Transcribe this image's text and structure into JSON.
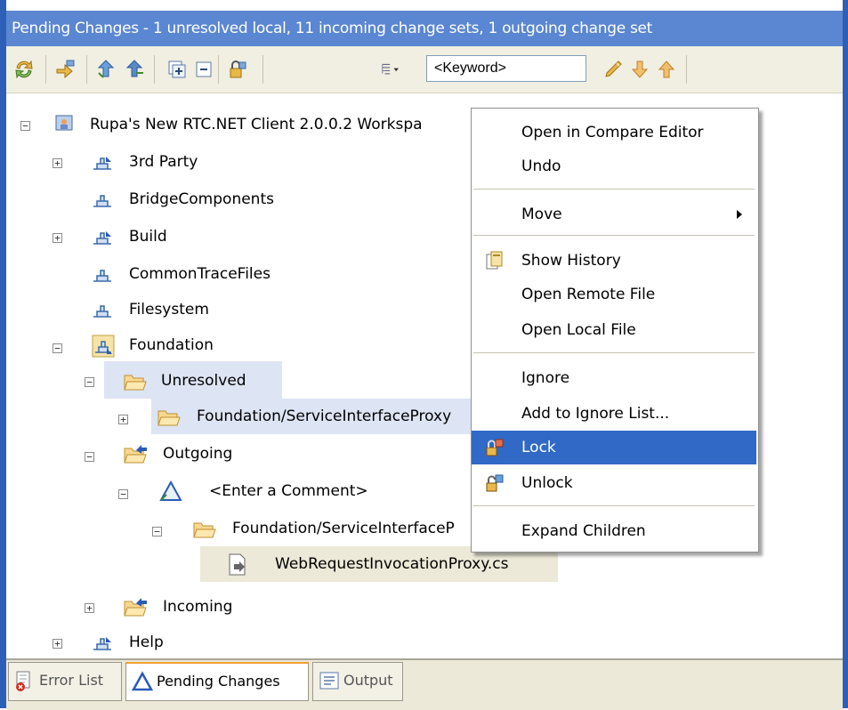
{
  "window": {
    "title": "Pending Changes - 1 unresolved local, 11 incoming change sets, 1 outgoing change set"
  },
  "toolbar": {
    "keyword_value": "<Keyword>",
    "icons": [
      "refresh-icon",
      "accept-icon",
      "check-in-icon",
      "deliver-icon",
      "expand-all-icon",
      "collapse-all-icon",
      "lock-icon",
      "filter-dropdown-icon",
      "search-icon",
      "next-icon",
      "previous-icon"
    ]
  },
  "tree": {
    "workspace": "Rupa's New RTC.NET Client 2.0.0.2 Workspa",
    "components": {
      "third_party": "3rd Party",
      "bridge": "BridgeComponents",
      "build": "Build",
      "trace": "CommonTraceFiles",
      "filesystem": "Filesystem",
      "foundation": "Foundation",
      "help": "Help"
    },
    "unresolved": "Unresolved",
    "unresolved_item": "Foundation/ServiceInterfaceProxy",
    "outgoing": "Outgoing",
    "comment": "<Enter a Comment>",
    "outgoing_folder": "Foundation/ServiceInterfaceP",
    "file": "WebRequestInvocationProxy.cs",
    "incoming": "Incoming"
  },
  "context_menu": {
    "items": [
      {
        "label": "Open in Compare Editor"
      },
      {
        "label": "Undo"
      },
      {
        "label": "Move"
      },
      {
        "label": "Show History"
      },
      {
        "label": "Open Remote File"
      },
      {
        "label": "Open Local File"
      },
      {
        "label": "Ignore"
      },
      {
        "label": "Add to Ignore List..."
      },
      {
        "label": "Lock"
      },
      {
        "label": "Unlock"
      },
      {
        "label": "Expand Children"
      }
    ],
    "selected": "Lock"
  },
  "bottom_tabs": [
    {
      "label": "Error List"
    },
    {
      "label": "Pending Changes"
    },
    {
      "label": "Output"
    }
  ],
  "colors": {
    "title_bar": "#5a86d2",
    "selection": "#3169c6",
    "frame": "#2e5fb7"
  }
}
